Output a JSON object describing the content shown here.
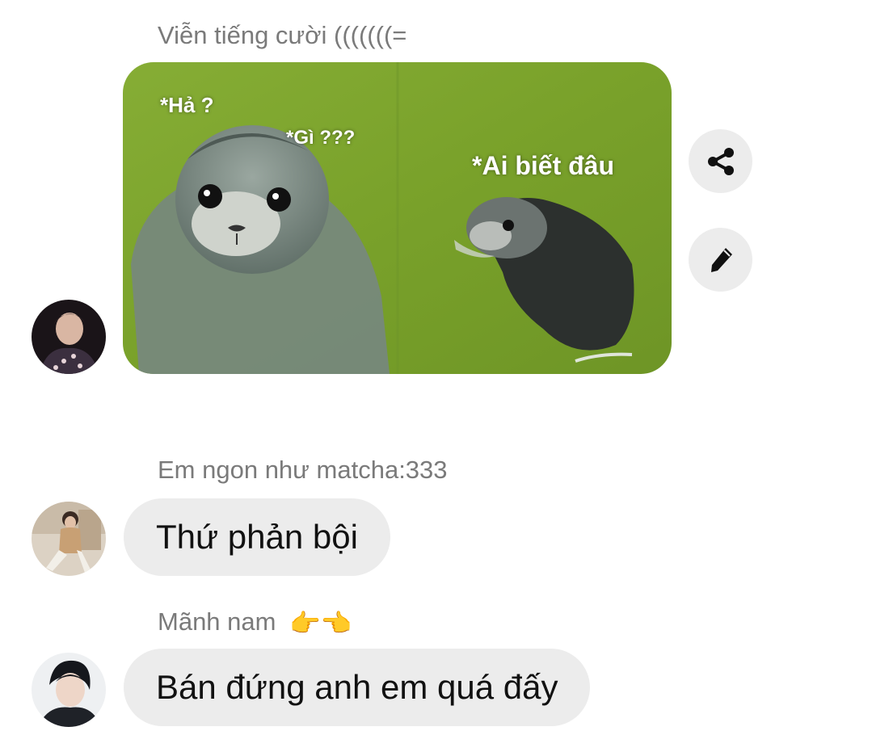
{
  "messages": [
    {
      "sender": "Viễn tiếng cười (((((((=",
      "type": "image"
    },
    {
      "sender": "Em ngon như matcha:333",
      "text": "Thứ phản bội"
    },
    {
      "sender": "Mãnh nam",
      "sender_emoji": "👉👈",
      "text": "Bán đứng anh em quá đấy"
    }
  ],
  "meme": {
    "caption_left_1": "*Hả ?",
    "caption_left_2": "*Gì ???",
    "caption_right": "*Ai biết đâu"
  },
  "actions": {
    "share_icon": "share-icon",
    "edit_icon": "pencil-icon"
  },
  "colors": {
    "bubble": "#ececec",
    "sender_text": "#7a7a7a",
    "meme_bg": "#7fa32c"
  }
}
